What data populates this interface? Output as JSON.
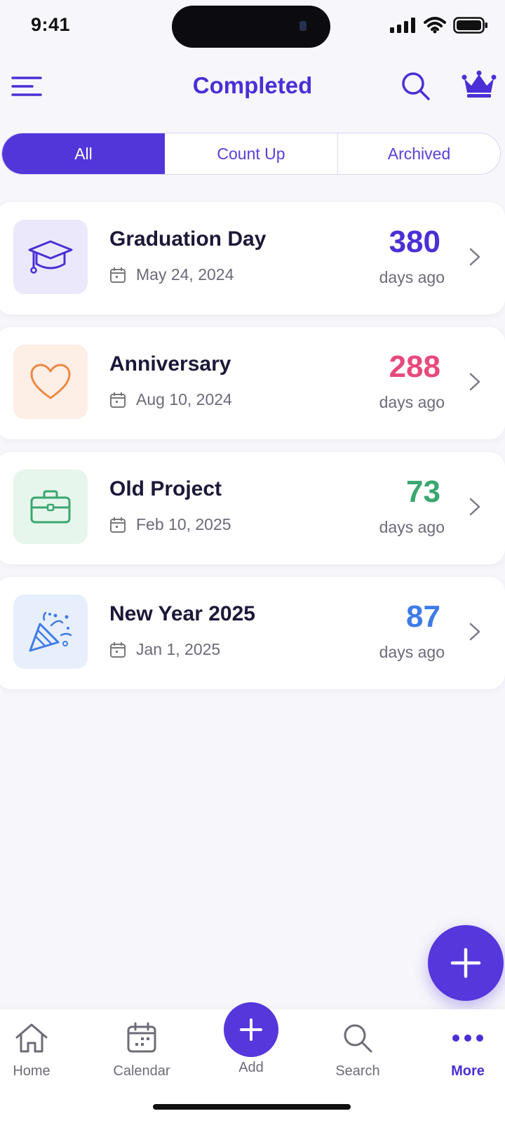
{
  "status_bar": {
    "time": "9:41"
  },
  "header": {
    "title": "Completed"
  },
  "tabs": [
    {
      "label": "All",
      "active": true
    },
    {
      "label": "Count Up",
      "active": false
    },
    {
      "label": "Archived",
      "active": false
    }
  ],
  "events": [
    {
      "title": "Graduation Day",
      "date": "May 24, 2024",
      "count": "380",
      "suffix": "days ago",
      "icon": "graduation-cap-icon",
      "color": "#4b2fd6",
      "bg": "#ece8fb"
    },
    {
      "title": "Anniversary",
      "date": "Aug 10, 2024",
      "count": "288",
      "suffix": "days ago",
      "icon": "heart-icon",
      "color": "#e8497c",
      "bg": "#fdeee6"
    },
    {
      "title": "Old Project",
      "date": "Feb 10, 2025",
      "count": "73",
      "suffix": "days ago",
      "icon": "briefcase-icon",
      "color": "#3aa770",
      "bg": "#e6f6ec"
    },
    {
      "title": "New Year 2025",
      "date": "Jan 1, 2025",
      "count": "87",
      "suffix": "days ago",
      "icon": "party-popper-icon",
      "color": "#3f7be8",
      "bg": "#e7effd"
    }
  ],
  "tab_bar": {
    "home": "Home",
    "calendar": "Calendar",
    "add": "Add",
    "search": "Search",
    "more": "More"
  },
  "colors": {
    "accent": "#5236d9"
  }
}
